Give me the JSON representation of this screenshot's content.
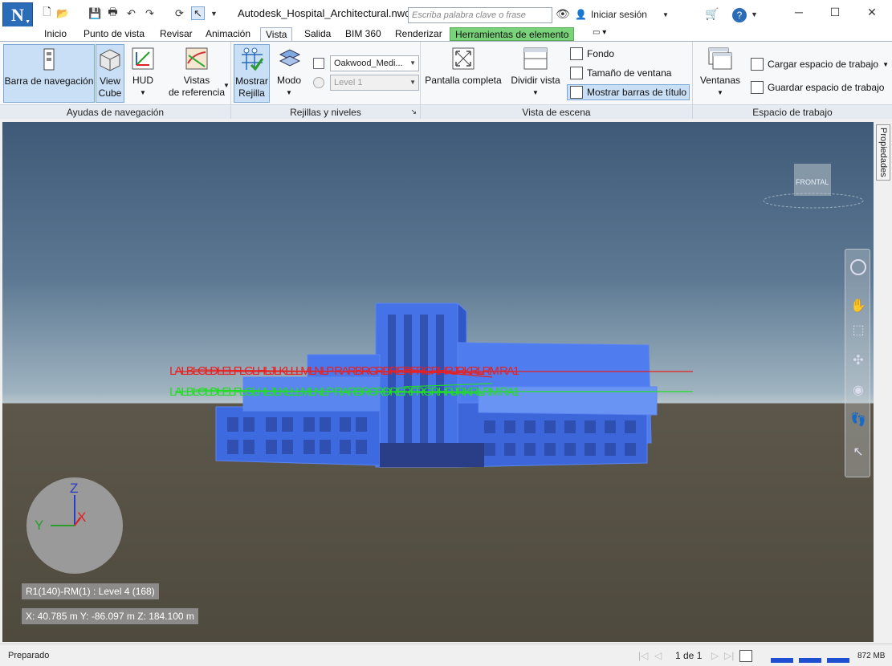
{
  "titlebar": {
    "app_letter": "N",
    "doc_title": "Autodesk_Hospital_Architectural.nwc",
    "search_placeholder": "Escriba palabra clave o frase",
    "signin_label": "Iniciar sesión"
  },
  "tabs": [
    {
      "label": "Inicio"
    },
    {
      "label": "Punto de vista"
    },
    {
      "label": "Revisar"
    },
    {
      "label": "Animación"
    },
    {
      "label": "Vista"
    },
    {
      "label": "Salida"
    },
    {
      "label": "BIM 360"
    },
    {
      "label": "Renderizar"
    },
    {
      "label": "Herramientas de elemento"
    }
  ],
  "ribbon": {
    "nav_aids": {
      "title": "Ayudas de navegación",
      "barra_navegacion": "Barra de navegación",
      "view_cube_1": "View",
      "view_cube_2": "Cube",
      "hud": "HUD",
      "vistas_1": "Vistas",
      "vistas_2": "de referencia"
    },
    "grids": {
      "title": "Rejillas y niveles",
      "mostrar_1": "Mostrar",
      "mostrar_2": "Rejilla",
      "modo": "Modo",
      "model_combo": "Oakwood_Medi...",
      "level_combo": "Level 1"
    },
    "scene": {
      "title": "Vista de escena",
      "pantalla_completa": "Pantalla completa",
      "dividir_vista": "Dividir vista",
      "fondo": "Fondo",
      "tamano_ventana": "Tamaño de ventana",
      "mostrar_barras": "Mostrar barras de título"
    },
    "workspace": {
      "title": "Espacio de trabajo",
      "ventanas": "Ventanas",
      "cargar": "Cargar espacio de trabajo",
      "guardar": "Guardar espacio de trabajo"
    }
  },
  "viewport": {
    "properties_tab": "Propiedades",
    "viewcube_face": "FRONTAL",
    "grid_info": "R1(140)-RM(1) : Level 4 (168)",
    "coords": "X: 40.785 m  Y: -86.097 m  Z: 184.100 m",
    "axis": {
      "z": "Z",
      "x": "X",
      "y": "Y"
    },
    "grid_labels_red": "LALBLCLDLELFLGLHLJLKLLLMLNLP  RARBRCRDRERFRGRHRJRKRLRM  RA1",
    "grid_labels_green": "LALBLCLDLELFLGLHLJLKLLLMLNLP  RARBRCRDRERFRGRHRJRKRLRM  RA1"
  },
  "statusbar": {
    "status": "Preparado",
    "page": "1 de 1",
    "memory": "872 MB"
  },
  "colors": {
    "accent": "#2b6cb8",
    "context_tab": "#7ad37a",
    "grid_red": "#e82020",
    "grid_green": "#22dd22",
    "building": "#3f6fe6"
  }
}
